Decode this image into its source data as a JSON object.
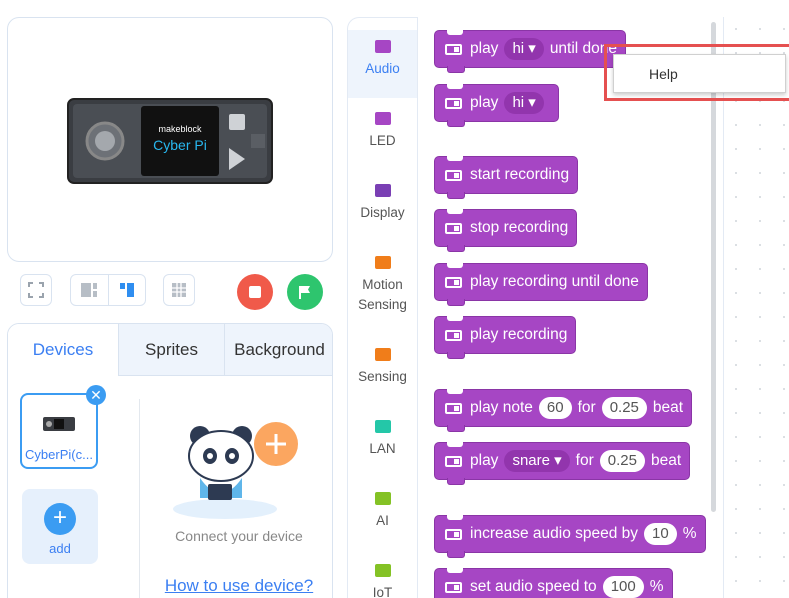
{
  "device": {
    "brand": "makeblock",
    "name": "Cyber Pi"
  },
  "toolbar": {
    "icons": [
      "fullscreen-icon",
      "layout-split-icon",
      "layout-small-icon",
      "grid-icon"
    ],
    "stop_color": "#f05a4a",
    "run_color": "#2ec56e"
  },
  "tabs": {
    "devices": "Devices",
    "sprites": "Sprites",
    "background": "Background"
  },
  "device_list": {
    "item_label": "CyberPi(c...",
    "add_label": "add",
    "connect_text": "Connect your device",
    "help_link": "How to use device?"
  },
  "categories": [
    {
      "label": "Audio",
      "color": "#a646c4"
    },
    {
      "label": "LED",
      "color": "#a646c4"
    },
    {
      "label": "Display",
      "color": "#7a3fb4"
    },
    {
      "label": "Motion Sensing",
      "color": "#f07d1a"
    },
    {
      "label": "Sensing",
      "color": "#f07d1a"
    },
    {
      "label": "LAN",
      "color": "#24c7a8"
    },
    {
      "label": "AI",
      "color": "#84c225"
    },
    {
      "label": "IoT",
      "color": "#84c225"
    }
  ],
  "blocks": {
    "b1": {
      "t1": "play",
      "dd": "hi ▾",
      "t2": "until done"
    },
    "b2": {
      "t1": "play",
      "dd": "hi ▾"
    },
    "b3": {
      "t1": "start recording"
    },
    "b4": {
      "t1": "stop recording"
    },
    "b5": {
      "t1": "play recording until done"
    },
    "b6": {
      "t1": "play recording"
    },
    "b7": {
      "t1": "play note",
      "v1": "60",
      "t2": "for",
      "v2": "0.25",
      "t3": "beat"
    },
    "b8": {
      "t1": "play",
      "dd": "snare ▾",
      "t2": "for",
      "v2": "0.25",
      "t3": "beat"
    },
    "b9": {
      "t1": "increase audio speed by",
      "v1": "10",
      "t2": "%"
    },
    "b10": {
      "t1": "set audio speed to",
      "v1": "100",
      "t2": "%"
    }
  },
  "context_menu": {
    "help": "Help"
  }
}
